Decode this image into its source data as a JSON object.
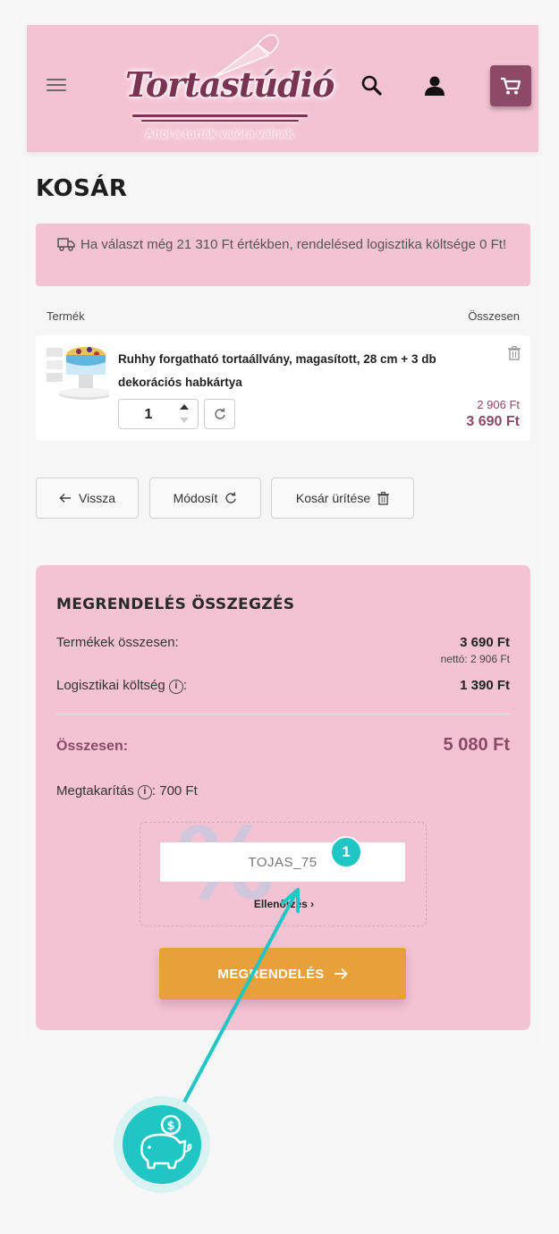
{
  "header": {
    "logo_text": "Tortastúdió",
    "logo_tagline": "Ahol a torták valóra válnak"
  },
  "page_title": "KOSÁR",
  "notice": "Ha választ még 21 310 Ft értékben, rendelésed logisztika költsége 0 Ft!",
  "columns": {
    "product": "Termék",
    "total": "Összesen"
  },
  "item": {
    "name": "Ruhhy forgatható tortaállvány, magasított, 28 cm + 3 db dekorációs habkártya",
    "quantity": "1",
    "price_net": "2 906 Ft",
    "price_gross": "3 690 Ft"
  },
  "actions": {
    "back": "Vissza",
    "modify": "Módosít",
    "empty": "Kosár ürítése"
  },
  "summary": {
    "title": "MEGRENDELÉS ÖSSZEGZÉS",
    "products_label": "Termékek összesen:",
    "products_value": "3 690 Ft",
    "products_net": "nettó: 2 906 Ft",
    "logistics_label": "Logisztikai költség",
    "logistics_value": "1 390 Ft",
    "total_label": "Összesen:",
    "total_value": "5 080 Ft",
    "savings_label": "Megtakarítás",
    "savings_value": ": 700 Ft",
    "coupon_value": "TOJAS_75",
    "coupon_check": "Ellenőrzés",
    "order_button": "MEGRENDELÉS"
  },
  "annotation": {
    "badge": "1"
  },
  "colors": {
    "header_bg": "#f4c3d3",
    "brand": "#8c4a66",
    "order_button": "#e8a13a",
    "annotation": "#1fc6c4"
  },
  "icons": [
    "menu-icon",
    "search-icon",
    "user-icon",
    "cart-icon",
    "truck-icon",
    "trash-icon",
    "refresh-icon",
    "arrow-left-icon",
    "info-icon",
    "arrow-right-icon",
    "piggy-bank-icon"
  ]
}
